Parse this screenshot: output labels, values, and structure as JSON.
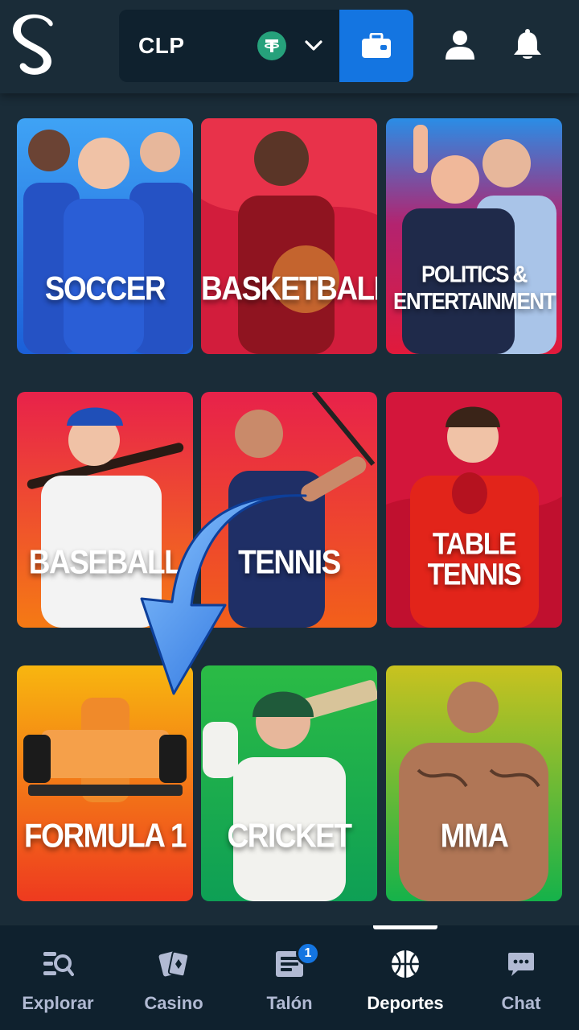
{
  "header": {
    "currency": "CLP",
    "token_icon": "tether-icon"
  },
  "sports": [
    {
      "label": "SOCCER",
      "bg": "#1e6fe0"
    },
    {
      "label": "BASKETBALL",
      "bg": "#d21d3c"
    },
    {
      "label": "POLITICS &\nENTERTAINMENT",
      "bg": "#d6204a"
    },
    {
      "label": "BASEBALL",
      "bg": "#ee3a1f"
    },
    {
      "label": "TENNIS",
      "bg": "#ea3a1a"
    },
    {
      "label": "TABLE\nTENNIS",
      "bg": "#d3163b"
    },
    {
      "label": "FORMULA 1",
      "bg": "#f39a0e"
    },
    {
      "label": "CRICKET",
      "bg": "#16b14a"
    },
    {
      "label": "MMA",
      "bg": "#2dbb40"
    }
  ],
  "nav": {
    "items": [
      {
        "label": "Explorar",
        "icon": "browse-icon"
      },
      {
        "label": "Casino",
        "icon": "casino-cards-icon"
      },
      {
        "label": "Talón",
        "icon": "betslip-icon",
        "badge": "1"
      },
      {
        "label": "Deportes",
        "icon": "basketball-icon",
        "active": true
      },
      {
        "label": "Chat",
        "icon": "chat-icon"
      }
    ]
  },
  "colors": {
    "background": "#1a2c38",
    "panel": "#0f212e",
    "accent": "#1475e1",
    "muted_text": "#b1bad3"
  }
}
